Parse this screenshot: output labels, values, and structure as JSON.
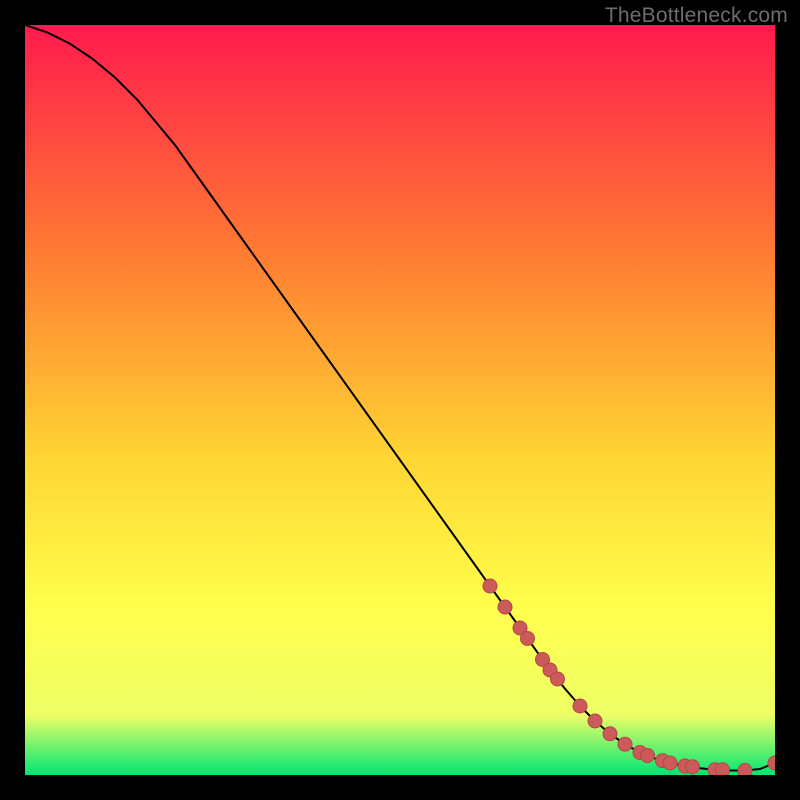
{
  "watermark": "TheBottleneck.com",
  "colors": {
    "gradient_top": "#ff1a4d",
    "gradient_mid1": "#ff7a33",
    "gradient_mid2": "#ffd633",
    "gradient_mid3": "#ffff4d",
    "gradient_mid4": "#eeff66",
    "gradient_bottom": "#00e673",
    "curve": "#000000",
    "marker_fill": "#cc5a5a",
    "marker_stroke": "#b34747",
    "frame": "#000000"
  },
  "chart_data": {
    "type": "line",
    "title": "",
    "xlabel": "",
    "ylabel": "",
    "xlim": [
      0,
      100
    ],
    "ylim": [
      0,
      100
    ],
    "series": [
      {
        "name": "curve",
        "x": [
          0,
          3,
          6,
          9,
          12,
          15,
          20,
          25,
          30,
          35,
          40,
          45,
          50,
          55,
          60,
          62,
          64,
          66,
          68,
          70,
          72,
          74,
          76,
          78,
          80,
          82,
          84,
          86,
          88,
          90,
          92,
          94,
          96,
          98,
          100
        ],
        "y": [
          100,
          99,
          97.5,
          95.5,
          93,
          90,
          84,
          77,
          70,
          63,
          56,
          49,
          42,
          35,
          28,
          25.2,
          22.4,
          19.6,
          16.8,
          14,
          11.5,
          9.2,
          7.2,
          5.5,
          4.1,
          3.0,
          2.2,
          1.6,
          1.2,
          0.9,
          0.7,
          0.6,
          0.6,
          0.8,
          1.6
        ]
      }
    ],
    "markers": {
      "name": "highlighted-points",
      "x": [
        62,
        64,
        66,
        67,
        69,
        70,
        71,
        74,
        76,
        78,
        80,
        82,
        83,
        85,
        86,
        88,
        89,
        92,
        93,
        96,
        100
      ],
      "y": [
        25.2,
        22.4,
        19.6,
        18.2,
        15.4,
        14.0,
        12.8,
        9.2,
        7.2,
        5.5,
        4.1,
        3.0,
        2.6,
        1.9,
        1.6,
        1.2,
        1.1,
        0.7,
        0.7,
        0.6,
        1.6
      ]
    }
  }
}
